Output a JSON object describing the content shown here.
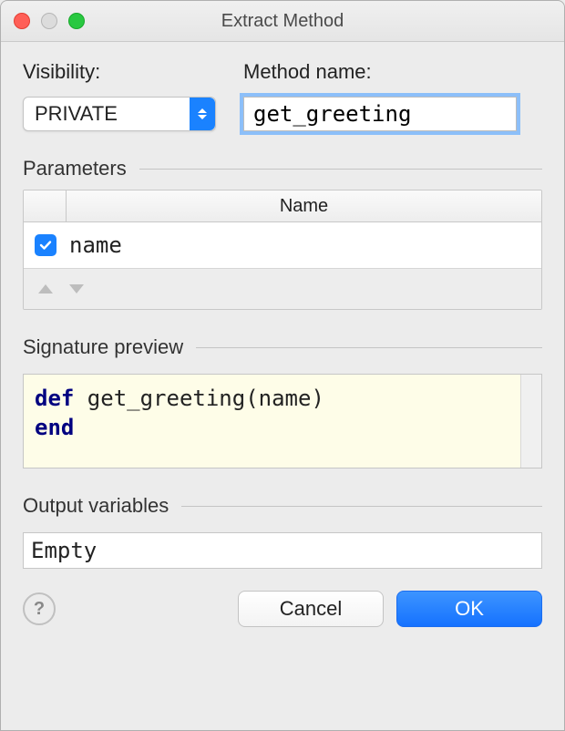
{
  "dialog": {
    "title": "Extract Method"
  },
  "labels": {
    "visibility": "Visibility:",
    "method_name": "Method name:"
  },
  "visibility": {
    "selected": "PRIVATE"
  },
  "method_name": {
    "value": "get_greeting"
  },
  "parameters": {
    "section_label": "Parameters",
    "columns": {
      "name": "Name"
    },
    "rows": [
      {
        "checked": true,
        "name": "name"
      }
    ]
  },
  "signature": {
    "section_label": "Signature preview",
    "kw_def": "def",
    "line1_rest": " get_greeting(name)",
    "kw_end": "end"
  },
  "output": {
    "section_label": "Output variables",
    "value": "Empty"
  },
  "buttons": {
    "help": "?",
    "cancel": "Cancel",
    "ok": "OK"
  }
}
